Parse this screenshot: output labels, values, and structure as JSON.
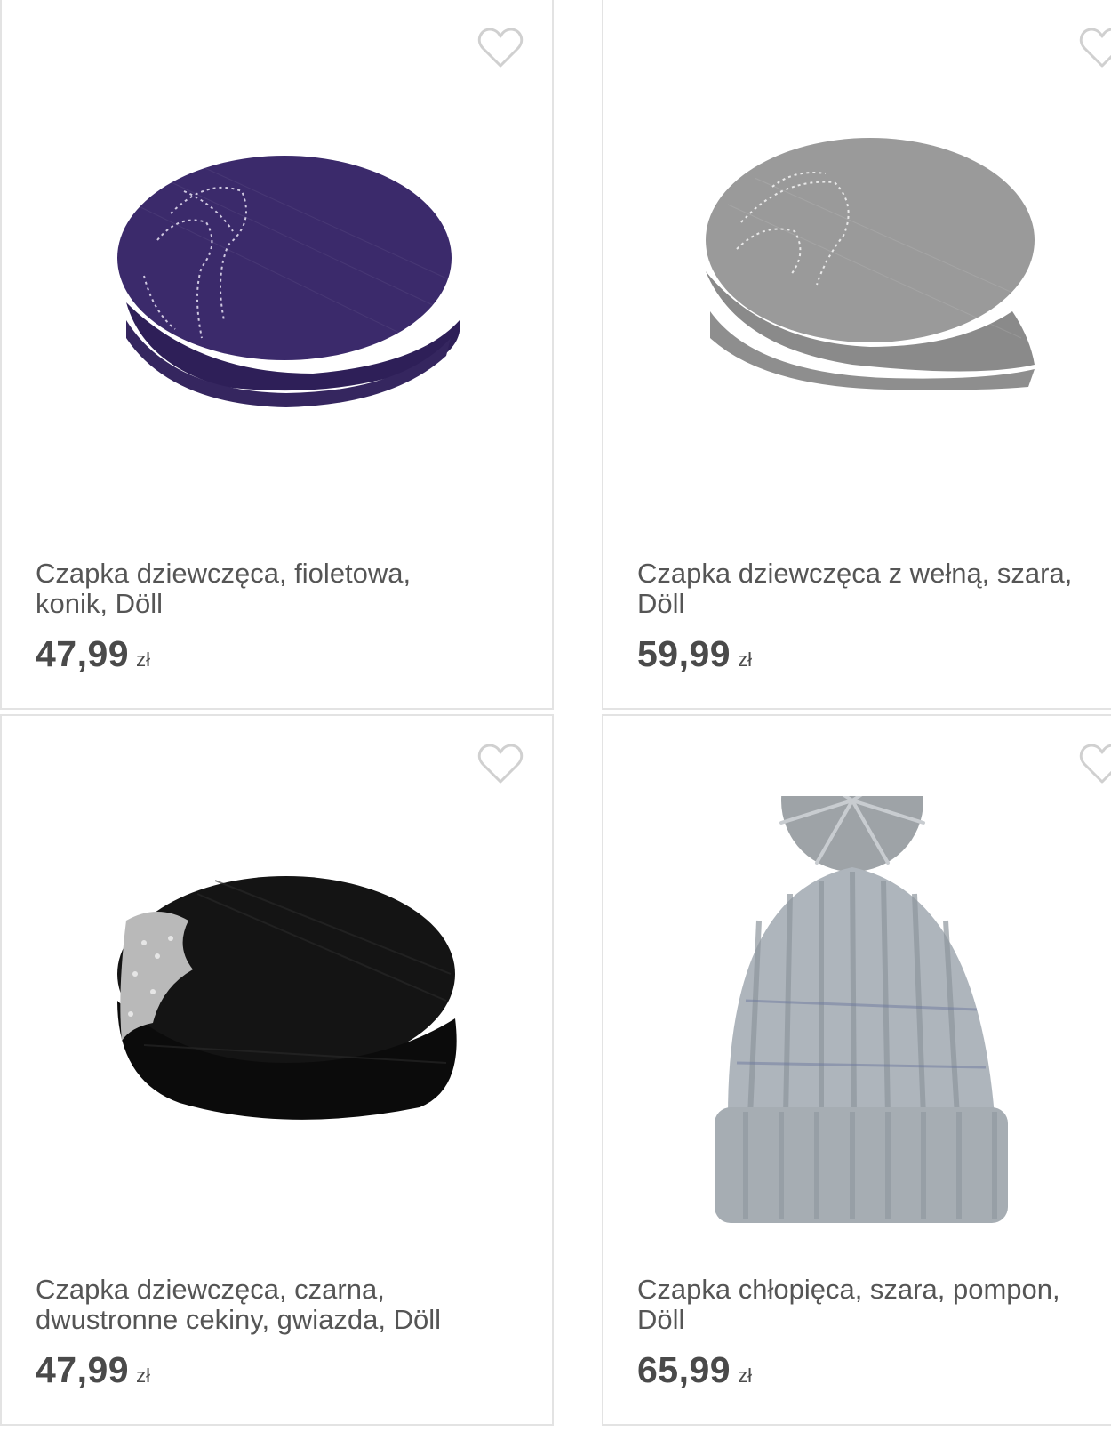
{
  "products": [
    {
      "title": "Czapka dziewczęca, fioletowa,\nkonik, Döll",
      "price": "47,99",
      "currency": "zł",
      "image": "purple-knit-beret-with-horse-rhinestones",
      "color": "#3b2a6b"
    },
    {
      "title": "Czapka dziewczęca z wełną, szara,\nDöll",
      "price": "59,99",
      "currency": "zł",
      "image": "grey-knit-beret-with-rhinestones",
      "color": "#9a9a9a"
    },
    {
      "title": "Czapka dziewczęca, czarna,\ndwustronne cekiny, gwiazda, Döll",
      "price": "47,99",
      "currency": "zł",
      "image": "black-knit-beret-with-sequin-star",
      "color": "#111111"
    },
    {
      "title": "Czapka chłopięca, szara, pompon,\nDöll",
      "price": "65,99",
      "currency": "zł",
      "image": "grey-melange-beanie-with-pompom",
      "color": "#a9b0b8"
    }
  ],
  "icons": {
    "favorite": "heart-outline-icon"
  }
}
